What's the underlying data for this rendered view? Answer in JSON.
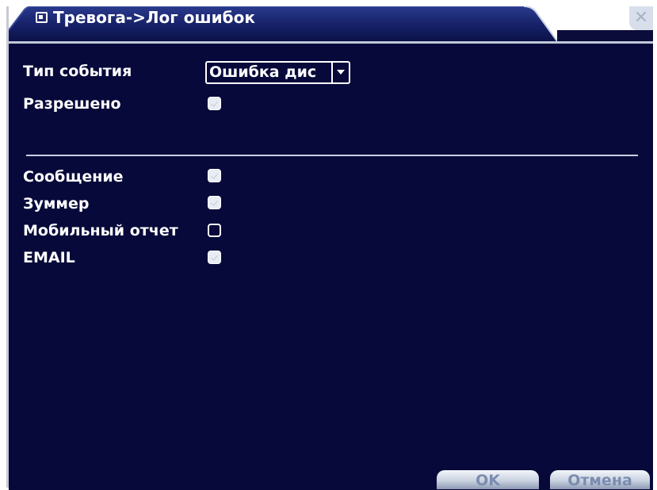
{
  "window": {
    "title": "Тревога->Лог ошибок",
    "close_symbol": "✕",
    "title_icon": "window-icon",
    "close_icon": "close-icon"
  },
  "event_type": {
    "label": "Тип события",
    "value": "Ошибка дис"
  },
  "enabled": {
    "label": "Разрешено",
    "checked": true
  },
  "actions": [
    {
      "label": "Сообщение",
      "checked": true
    },
    {
      "label": "Зуммер",
      "checked": true
    },
    {
      "label": "Мобильный отчет",
      "checked": false
    },
    {
      "label": "EMAIL",
      "checked": true
    }
  ],
  "buttons": {
    "ok": "OK",
    "cancel": "Отмена"
  },
  "colors": {
    "background": "#07093a",
    "text": "#ffffff",
    "button_text": "#7b8caf"
  }
}
